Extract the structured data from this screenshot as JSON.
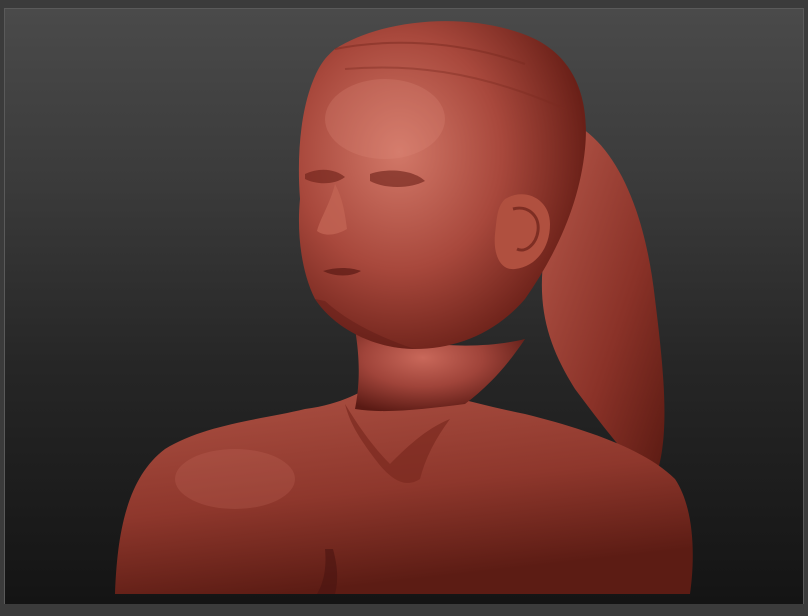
{
  "app": {
    "window": "3d-sculpt-viewport"
  },
  "viewport": {
    "background_top": "#4a4a4a",
    "background_bottom": "#141414",
    "frame_color": "#3b3b3b"
  },
  "model": {
    "subject": "sculpted-bust",
    "material_color": "#a0443a",
    "highlight_color": "#d07a6a",
    "shadow_color": "#4a1410"
  }
}
